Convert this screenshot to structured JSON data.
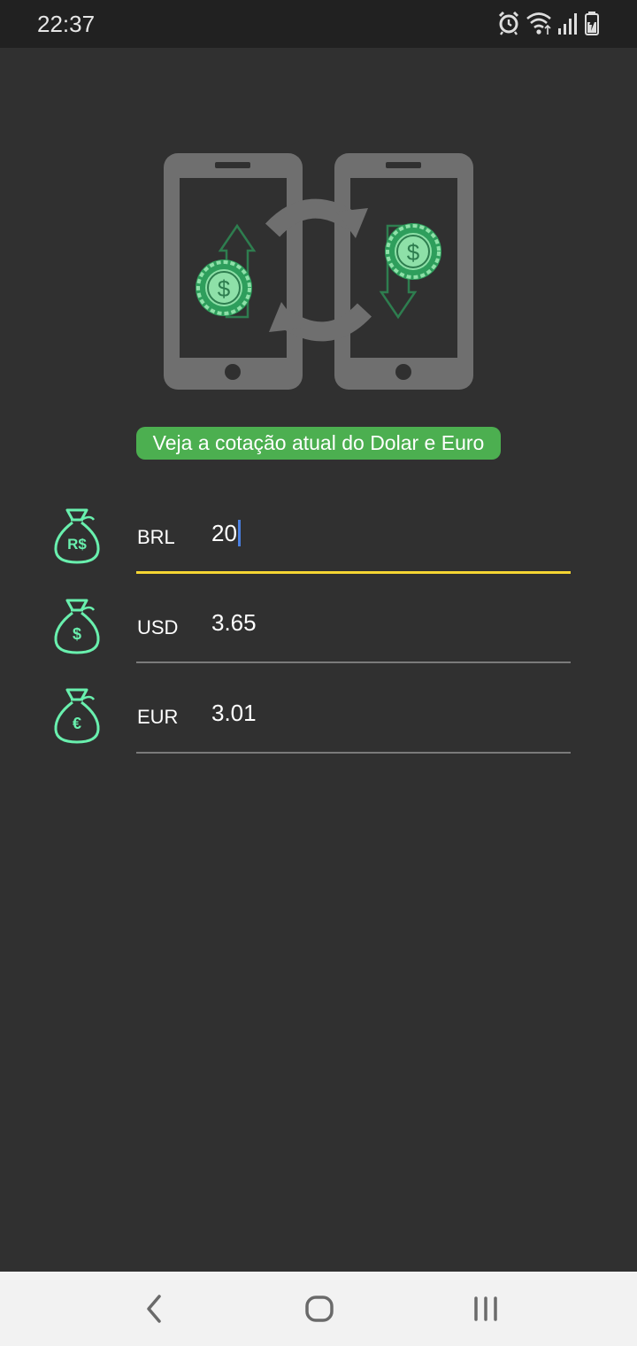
{
  "status_bar": {
    "time": "22:37",
    "icons": [
      "alarm-icon",
      "wifi-icon",
      "signal-icon",
      "battery-charging-icon"
    ]
  },
  "hero": {
    "icon": "currency-exchange-phones-illustration"
  },
  "banner": {
    "text": "Veja a cotação atual do Dolar e Euro",
    "color": "#4caf50"
  },
  "currencies": [
    {
      "code": "BRL",
      "value": "20",
      "symbol": "R$",
      "focused": true
    },
    {
      "code": "USD",
      "value": "3.65",
      "symbol": "$",
      "focused": false
    },
    {
      "code": "EUR",
      "value": "3.01",
      "symbol": "€",
      "focused": false
    }
  ],
  "colors": {
    "background": "#303030",
    "accent_green": "#69f0ae",
    "focus_underline": "#f5d532",
    "caret": "#4a7fe0"
  },
  "nav_bar": {
    "icons": [
      "back-icon",
      "home-icon",
      "recents-icon"
    ]
  }
}
